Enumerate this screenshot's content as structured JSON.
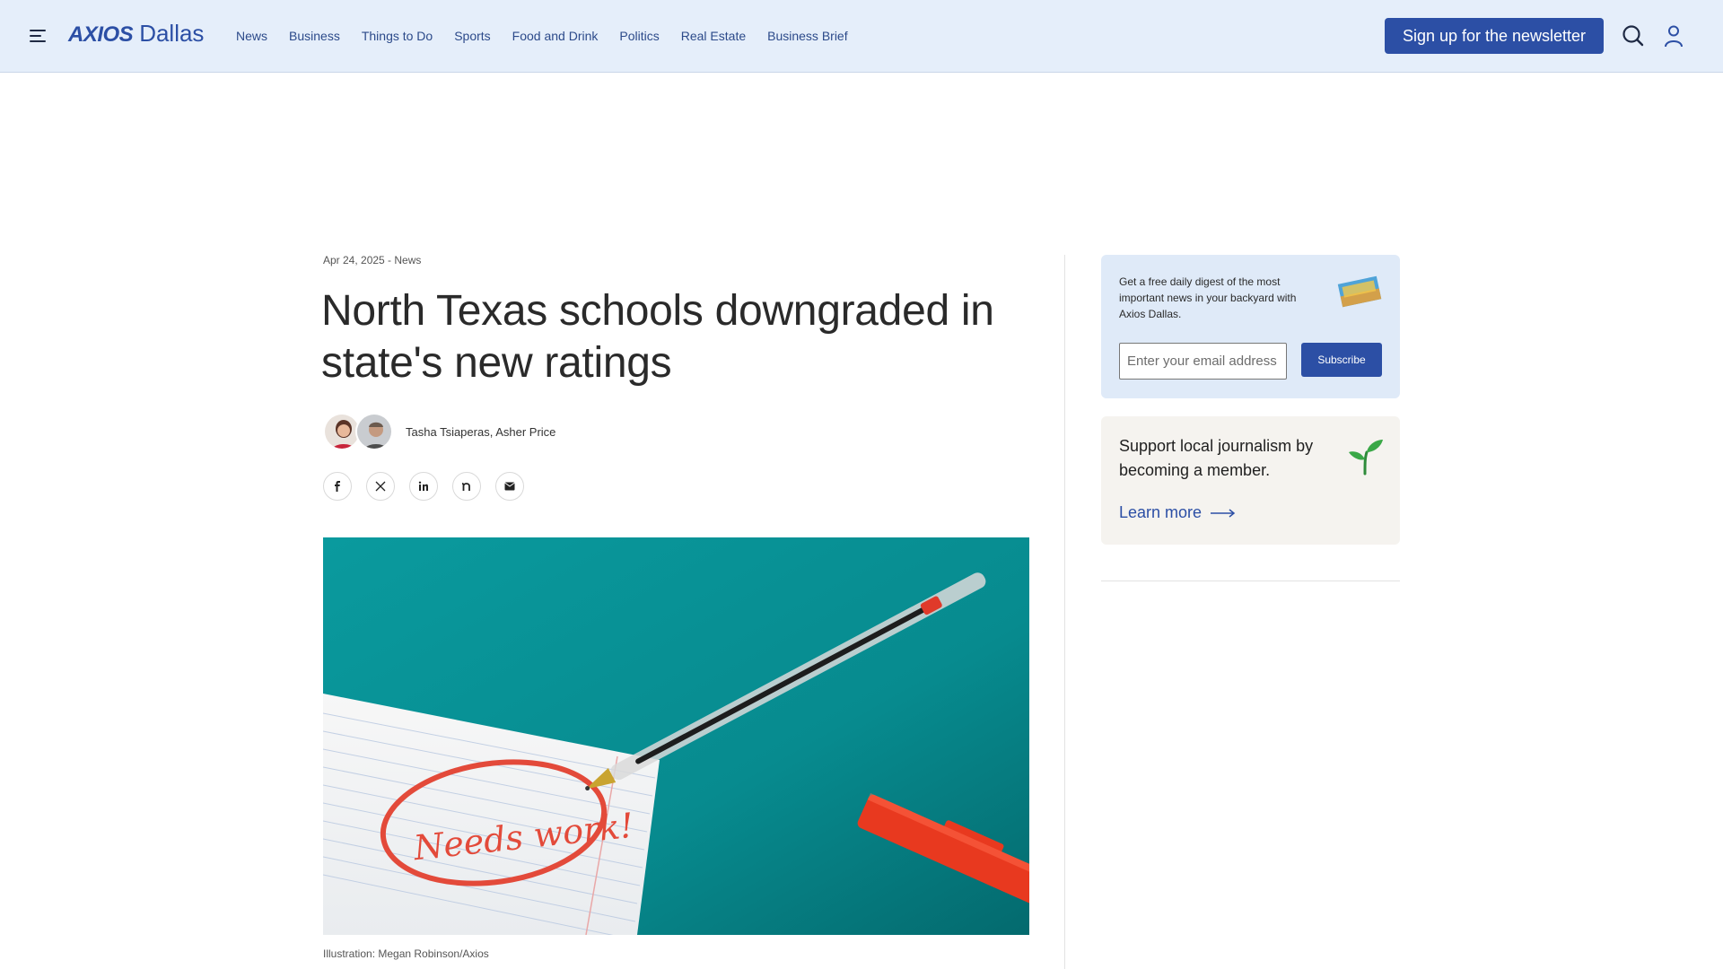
{
  "header": {
    "brand": "AXIOS",
    "city": "Dallas",
    "nav": [
      "News",
      "Business",
      "Things to Do",
      "Sports",
      "Food and Drink",
      "Politics",
      "Real Estate",
      "Business Brief"
    ],
    "signup_label": "Sign up for the newsletter",
    "accent_color": "#2c4fa5",
    "header_bg": "#e5eefa"
  },
  "article": {
    "meta": "Apr 24, 2025 - News",
    "title": "North Texas schools downgraded in state's new ratings",
    "authors": "Tasha Tsiaperas, Asher Price",
    "share_icons": [
      "facebook-icon",
      "x-icon",
      "linkedin-icon",
      "nextdoor-icon",
      "email-icon"
    ],
    "hero_handwriting": "Needs work!",
    "caption": "Illustration: Megan Robinson/Axios"
  },
  "sidebar": {
    "newsletter": {
      "text": "Get a free daily digest of the most important news in your backyard with Axios Dallas.",
      "placeholder": "Enter your email address",
      "button_label": "Subscribe"
    },
    "membership": {
      "text": "Support local journalism by becoming a member.",
      "link_label": "Learn more"
    }
  }
}
